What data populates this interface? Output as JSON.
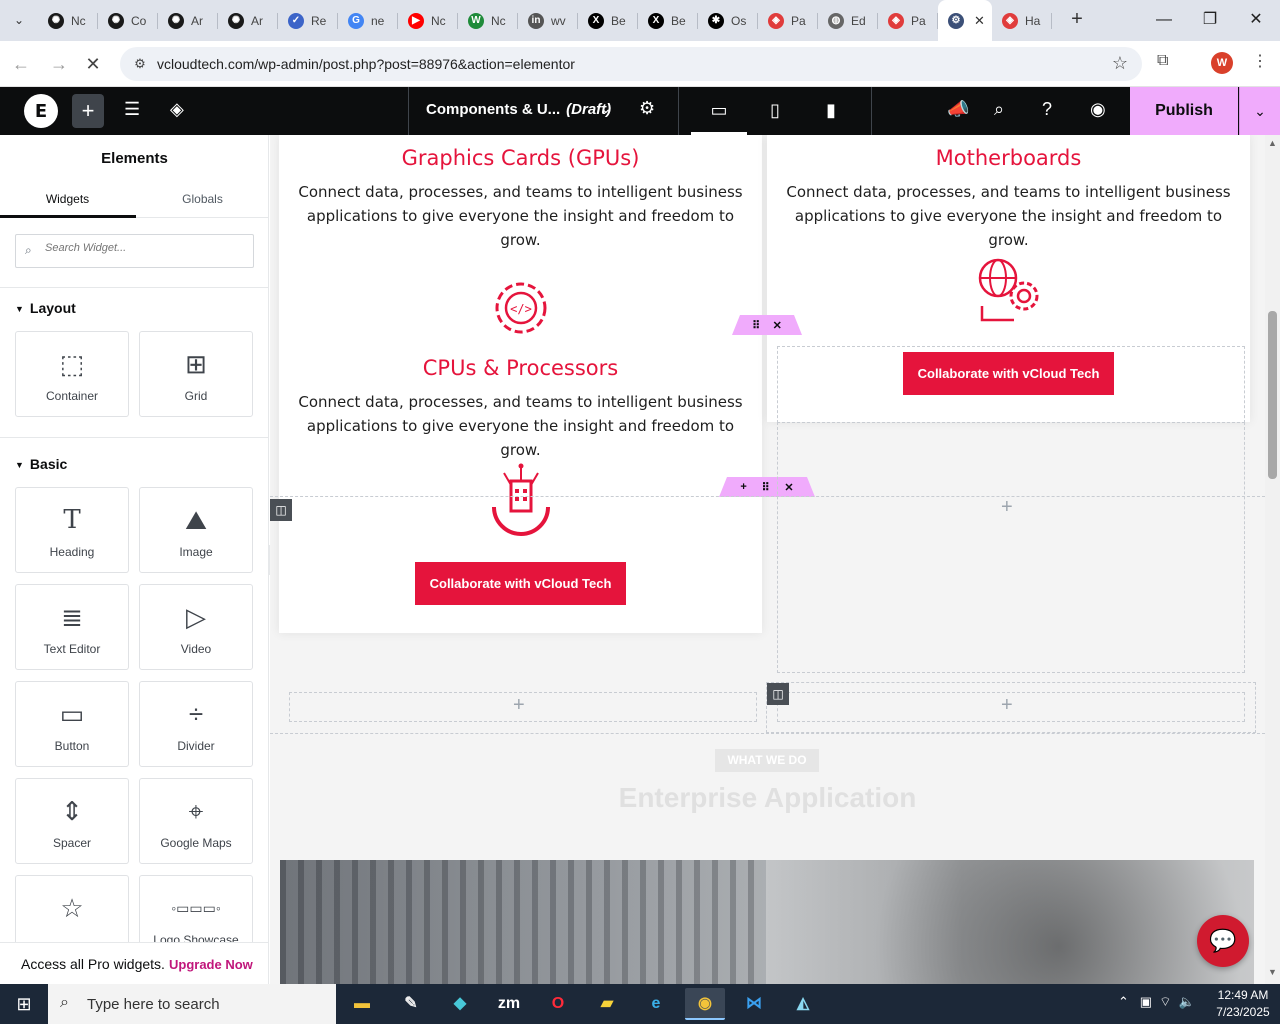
{
  "browser": {
    "tabs": [
      {
        "label": "Nc",
        "icon": "openai-icon",
        "color": "#1a1a1a"
      },
      {
        "label": "Co",
        "icon": "openai-icon",
        "color": "#1a1a1a"
      },
      {
        "label": "Ar",
        "icon": "openai-icon",
        "color": "#1a1a1a"
      },
      {
        "label": "Ar",
        "icon": "openai-icon",
        "color": "#1a1a1a"
      },
      {
        "label": "Re",
        "icon": "wordpress-icon",
        "color": "#3c64c8"
      },
      {
        "label": "ne",
        "icon": "google-icon",
        "color": "#4285f4"
      },
      {
        "label": "Nc",
        "icon": "youtube-icon",
        "color": "#ff0000"
      },
      {
        "label": "Nc",
        "icon": "w-icon",
        "color": "#1f8b3a"
      },
      {
        "label": "wv",
        "icon": "linkedin-icon",
        "color": "#555555"
      },
      {
        "label": "Be",
        "icon": "x-icon",
        "color": "#000000"
      },
      {
        "label": "Be",
        "icon": "x-icon",
        "color": "#000000"
      },
      {
        "label": "Os",
        "icon": "star-icon",
        "color": "#000000"
      },
      {
        "label": "Pa",
        "icon": "tag-icon",
        "color": "#e03c3c"
      },
      {
        "label": "Ed",
        "icon": "globe-icon",
        "color": "#666666"
      },
      {
        "label": "Pa",
        "icon": "tag-icon",
        "color": "#e03c3c"
      },
      {
        "label": "",
        "icon": "gear-globe-icon",
        "color": "#3c5078",
        "active": true
      },
      {
        "label": "Ha",
        "icon": "tag-icon",
        "color": "#e03c3c"
      }
    ],
    "url": "vcloudtech.com/wp-admin/post.php?post=88976&action=elementor",
    "profile_initial": "W"
  },
  "editor": {
    "doc_title": "Components & U...",
    "doc_status": "(Draft)",
    "publish_label": "Publish"
  },
  "sidebar": {
    "title": "Elements",
    "tabs": [
      "Widgets",
      "Globals"
    ],
    "search_placeholder": "Search Widget...",
    "categories": {
      "layout": "Layout",
      "basic": "Basic"
    },
    "layout_widgets": [
      {
        "label": "Container",
        "icon": "container-icon"
      },
      {
        "label": "Grid",
        "icon": "grid-icon"
      }
    ],
    "basic_widgets": [
      {
        "label": "Heading",
        "icon": "heading-icon"
      },
      {
        "label": "Image",
        "icon": "image-icon"
      },
      {
        "label": "Text Editor",
        "icon": "text-editor-icon"
      },
      {
        "label": "Video",
        "icon": "video-icon"
      },
      {
        "label": "Button",
        "icon": "button-icon"
      },
      {
        "label": "Divider",
        "icon": "divider-icon"
      },
      {
        "label": "Spacer",
        "icon": "spacer-icon"
      },
      {
        "label": "Google Maps",
        "icon": "map-icon"
      },
      {
        "label": "",
        "icon": "star-icon"
      },
      {
        "label": "Logo Showcase",
        "icon": "logo-showcase-icon"
      }
    ],
    "promo_text": "Access all Pro widgets.",
    "promo_link": "Upgrade Now"
  },
  "canvas": {
    "cards": {
      "gpu": {
        "title": "Graphics Cards (GPUs)",
        "body": "Connect data, processes, and teams to intelligent business applications to give everyone the insight and freedom to grow."
      },
      "motherboards": {
        "title": "Motherboards",
        "body": "Connect data, processes, and teams to intelligent business applications to give everyone the insight and freedom to grow.",
        "cta": "Collaborate with vCloud Tech"
      },
      "cpus": {
        "title": "CPUs & Processors",
        "body": "Connect data, processes, and teams to intelligent business applications to give everyone the insight and freedom to grow.",
        "cta": "Collaborate with vCloud Tech"
      }
    },
    "section_badge": "WHAT WE DO",
    "section_title": "Enterprise Application",
    "accent_color": "#e5143c"
  },
  "taskbar": {
    "search_placeholder": "Type here to search",
    "time": "12:49 AM",
    "date": "7/23/2025"
  }
}
